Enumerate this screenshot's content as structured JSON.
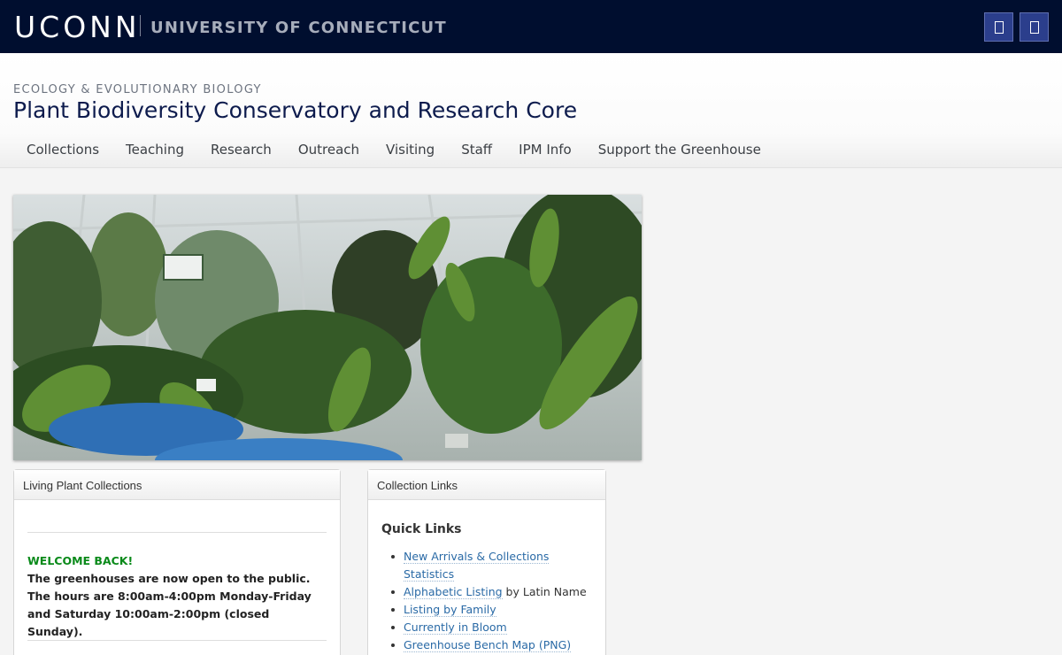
{
  "topbar": {
    "logo": "UCONN",
    "university": "UNIVERSITY OF CONNECTICUT",
    "buttons": [
      {
        "icon": "search-icon"
      },
      {
        "icon": "menu-icon"
      }
    ],
    "background": "#000e2f"
  },
  "header": {
    "department": "ECOLOGY & EVOLUTIONARY BIOLOGY",
    "title": "Plant Biodiversity Conservatory and Research Core",
    "nav": [
      "Collections",
      "Teaching",
      "Research",
      "Outreach",
      "Visiting",
      "Staff",
      "IPM Info",
      "Support the Greenhouse"
    ]
  },
  "living_panel": {
    "heading": "Living Plant Collections",
    "welcome": "WELCOME BACK!",
    "message": "The greenhouses are now open to the public. The hours are 8:00am-4:00pm Monday-Friday and Saturday 10:00am-2:00pm (closed Sunday)."
  },
  "links_panel": {
    "heading": "Collection Links",
    "quick_title": "Quick Links",
    "links": [
      {
        "text": "New Arrivals & Collections Statistics",
        "suffix": ""
      },
      {
        "text": "Alphabetic Listing",
        "suffix": " by Latin Name"
      },
      {
        "text": "Listing by Family",
        "suffix": ""
      },
      {
        "text": "Currently in Bloom",
        "suffix": ""
      },
      {
        "text": "Greenhouse Bench Map (PNG)",
        "suffix": ""
      }
    ]
  },
  "colors": {
    "accent_green": "#0a8a1a",
    "link": "#2a6aa6",
    "title_navy": "#0d1b4d"
  }
}
